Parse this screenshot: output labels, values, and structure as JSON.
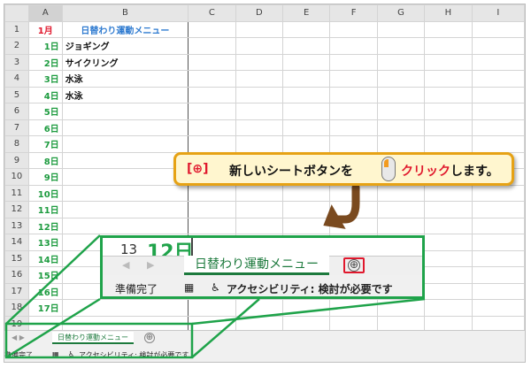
{
  "columns": [
    "A",
    "B",
    "C",
    "D",
    "E",
    "F",
    "G",
    "H",
    "I"
  ],
  "rows": [
    {
      "n": "1",
      "a": "1月",
      "b": "日替わり運動メニュー"
    },
    {
      "n": "2",
      "a": "1日",
      "b": "ジョギング"
    },
    {
      "n": "3",
      "a": "2日",
      "b": "サイクリング"
    },
    {
      "n": "4",
      "a": "3日",
      "b": "水泳"
    },
    {
      "n": "5",
      "a": "4日",
      "b": "水泳"
    },
    {
      "n": "6",
      "a": "5日",
      "b": ""
    },
    {
      "n": "7",
      "a": "6日",
      "b": ""
    },
    {
      "n": "8",
      "a": "7日",
      "b": ""
    },
    {
      "n": "9",
      "a": "8日",
      "b": ""
    },
    {
      "n": "10",
      "a": "9日",
      "b": ""
    },
    {
      "n": "11",
      "a": "10日",
      "b": ""
    },
    {
      "n": "12",
      "a": "11日",
      "b": ""
    },
    {
      "n": "13",
      "a": "12日",
      "b": ""
    },
    {
      "n": "14",
      "a": "13日",
      "b": ""
    },
    {
      "n": "15",
      "a": "14日",
      "b": ""
    },
    {
      "n": "16",
      "a": "15日",
      "b": ""
    },
    {
      "n": "17",
      "a": "16日",
      "b": ""
    },
    {
      "n": "18",
      "a": "17日",
      "b": ""
    },
    {
      "n": "19",
      "a": "",
      "b": ""
    }
  ],
  "sheet_tab": "日替わり運動メニュー",
  "new_sheet_symbol": "⊕",
  "nav_arrows": "◀ ▶",
  "status": {
    "ready": "準備完了",
    "accessibility": "アクセシビリティ: 検討が必要です"
  },
  "zoom": {
    "row_number": "13",
    "cell_preview": "12日"
  },
  "callout": {
    "bracket_text": "[⊕]",
    "main_text": "新しいシートボタンを",
    "action": "クリック",
    "suffix": "します。"
  },
  "colors": {
    "accent_green": "#1fa34a",
    "highlight_red": "#e0182d",
    "callout_border": "#e6a215",
    "callout_fill": "#fff6cf"
  }
}
